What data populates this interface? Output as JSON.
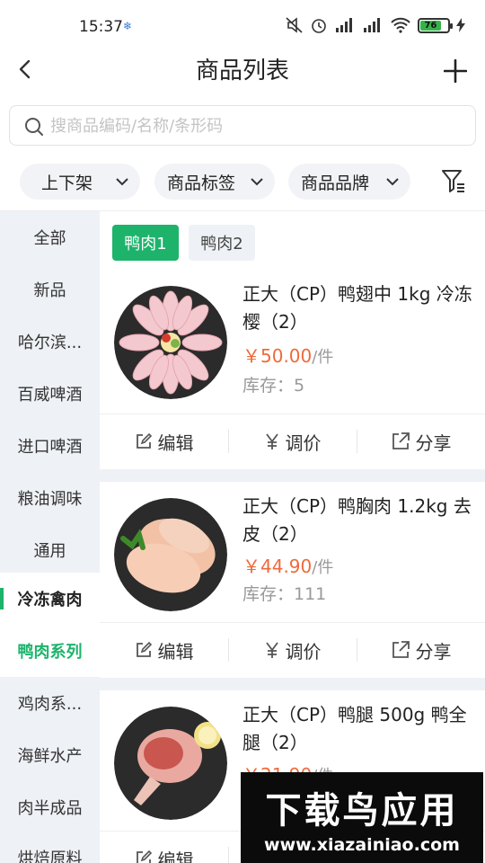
{
  "status_bar": {
    "time": "15:37",
    "battery": "76"
  },
  "header": {
    "title": "商品列表"
  },
  "search": {
    "placeholder": "搜商品编码/名称/条形码"
  },
  "filters": [
    {
      "label": "上下架"
    },
    {
      "label": "商品标签"
    },
    {
      "label": "商品品牌"
    }
  ],
  "sidebar": {
    "items": [
      {
        "label": "全部"
      },
      {
        "label": "新品"
      },
      {
        "label": "哈尔滨..."
      },
      {
        "label": "百威啤酒"
      },
      {
        "label": "进口啤酒"
      },
      {
        "label": "粮油调味"
      },
      {
        "label": "通用"
      },
      {
        "label": "冷冻禽肉"
      },
      {
        "label": "鸭肉系列"
      },
      {
        "label": "鸡肉系..."
      },
      {
        "label": "海鲜水产"
      },
      {
        "label": "肉半成品"
      },
      {
        "label": "烘焙原料"
      }
    ]
  },
  "subtabs": [
    {
      "label": "鸭肉1"
    },
    {
      "label": "鸭肉2"
    }
  ],
  "products": [
    {
      "name": "正大（CP）鸭翅中 1kg 冷冻樱（2）",
      "price": "￥50.00",
      "unit": "/件",
      "stock": "库存：5"
    },
    {
      "name": "正大（CP）鸭胸肉 1.2kg 去皮（2）",
      "price": "￥44.90",
      "unit": "/件",
      "stock": "库存：111"
    },
    {
      "name": "正大（CP）鸭腿 500g 鸭全腿（2）",
      "price": "￥21.90",
      "unit": "/件",
      "stock": ""
    }
  ],
  "actions": {
    "edit": "编辑",
    "price": "调价",
    "share": "分享"
  },
  "watermark": {
    "title": "下载鸟应用",
    "url": "www.xiazainiao.com"
  },
  "colors": {
    "accent": "#1db36b",
    "price": "#ef6a3b",
    "sidebar_bg": "#eef1f5"
  }
}
